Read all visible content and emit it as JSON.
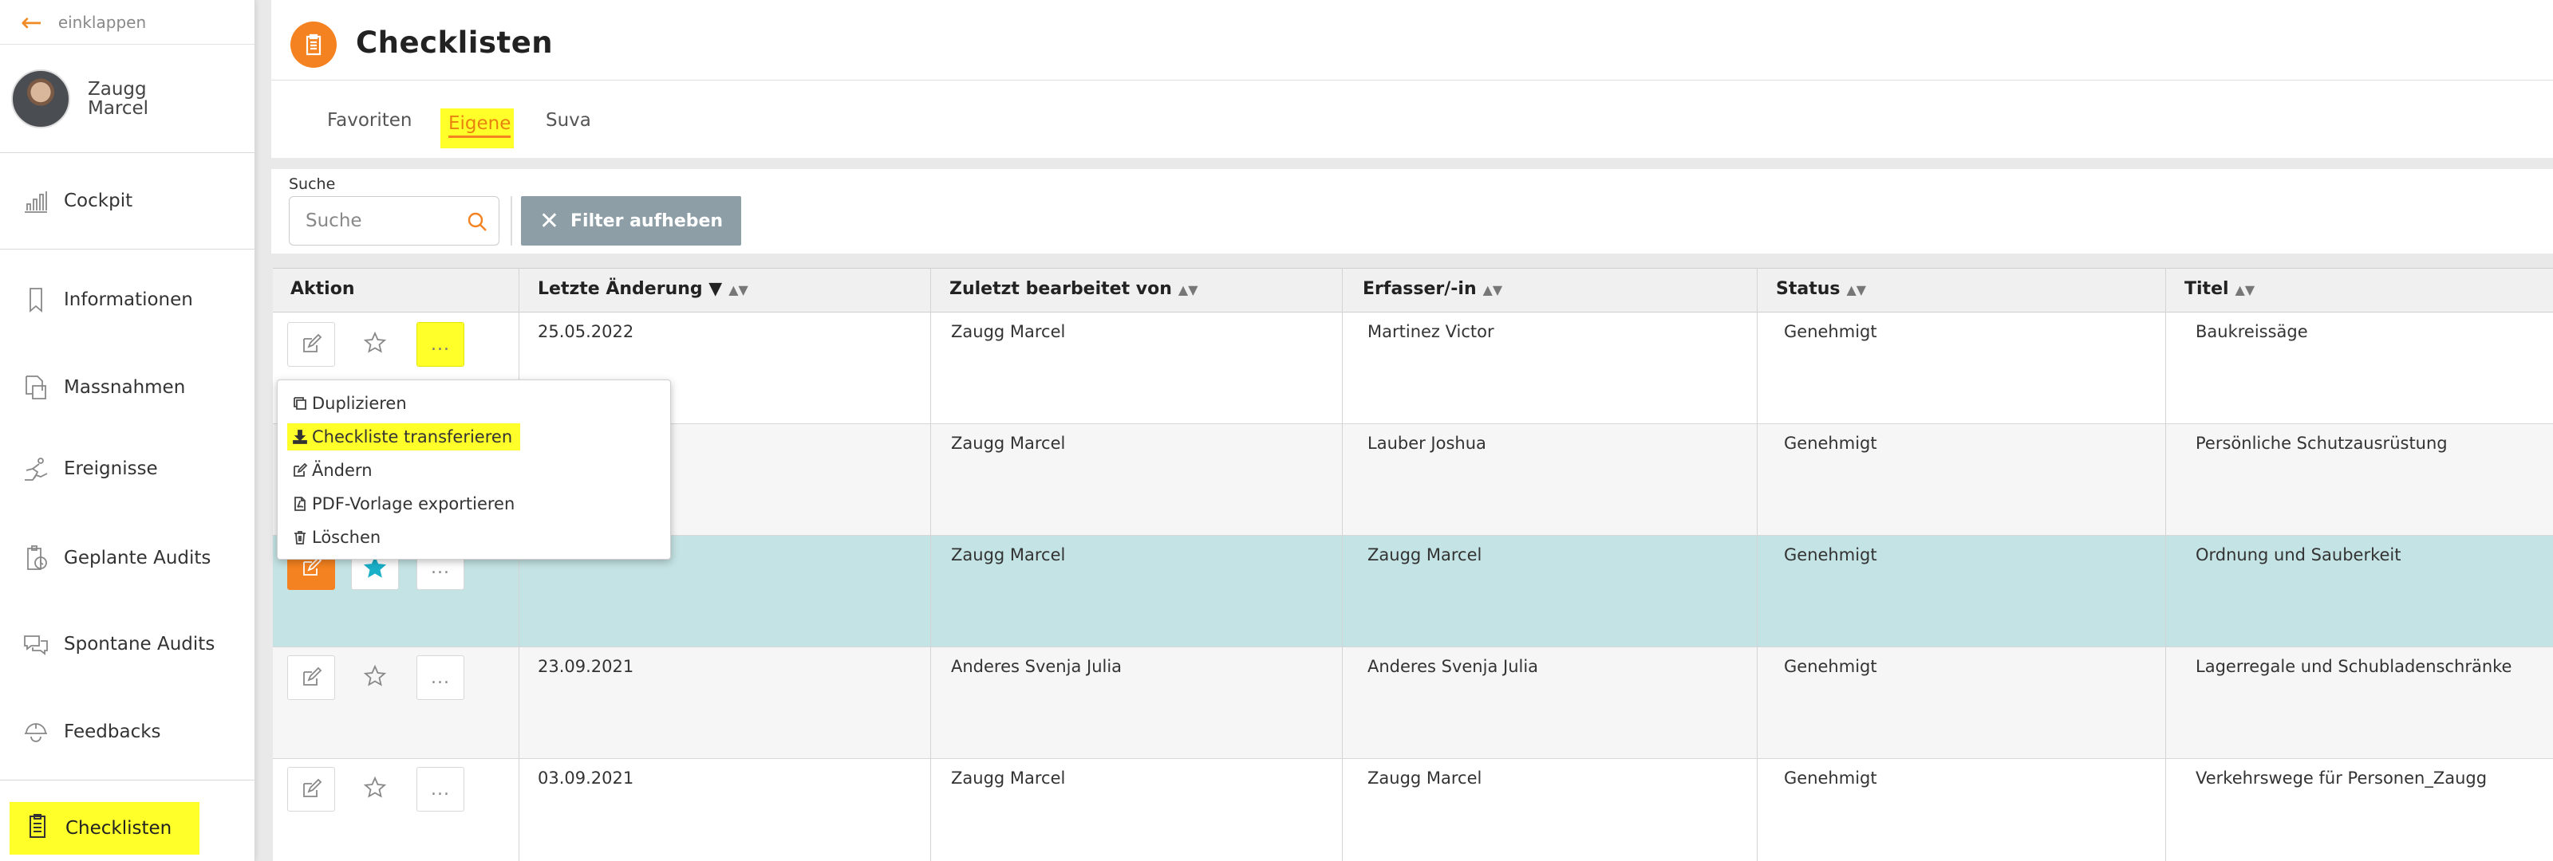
{
  "sidebar": {
    "collapse_label": "einklappen",
    "user_name_line1": "Zaugg",
    "user_name_line2": "Marcel",
    "items": [
      {
        "label": "Cockpit",
        "icon": "bar-chart-icon"
      },
      {
        "label": "Informationen",
        "icon": "bookmark-icon"
      },
      {
        "label": "Massnahmen",
        "icon": "documents-icon"
      },
      {
        "label": "Ereignisse",
        "icon": "fall-person-icon"
      },
      {
        "label": "Geplante Audits",
        "icon": "clock-clipboard-icon"
      },
      {
        "label": "Spontane Audits",
        "icon": "chat-bubbles-icon"
      },
      {
        "label": "Feedbacks",
        "icon": "helmet-icon"
      },
      {
        "label": "Checklisten",
        "icon": "clipboard-icon",
        "active": true
      }
    ]
  },
  "page": {
    "title": "Checklisten",
    "tabs": [
      "Favoriten",
      "Eigene",
      "Suva"
    ],
    "active_tab": "Eigene"
  },
  "search": {
    "label": "Suche",
    "placeholder": "Suche",
    "filter_button": "Filter aufheben"
  },
  "table": {
    "columns": [
      "Aktion",
      "Letzte Änderung ▼",
      "Zuletzt bearbeitet von",
      "Erfasser/-in",
      "Status",
      "Titel"
    ],
    "rows": [
      {
        "date": "25.05.2022",
        "edited_by": "Zaugg Marcel",
        "author": "Martinez Victor",
        "status": "Genehmigt",
        "title": "Baukreissäge"
      },
      {
        "date": "",
        "edited_by": "Zaugg Marcel",
        "author": "Lauber Joshua",
        "status": "Genehmigt",
        "title": "Persönliche Schutzausrüstung"
      },
      {
        "date": "",
        "edited_by": "Zaugg Marcel",
        "author": "Zaugg Marcel",
        "status": "Genehmigt",
        "title": "Ordnung und Sauberkeit"
      },
      {
        "date": "23.09.2021",
        "edited_by": "Anderes Svenja Julia",
        "author": "Anderes Svenja Julia",
        "status": "Genehmigt",
        "title": "Lagerregale und Schubladenschränke"
      },
      {
        "date": "03.09.2021",
        "edited_by": "Zaugg Marcel",
        "author": "Zaugg Marcel",
        "status": "Genehmigt",
        "title": "Verkehrswege für Personen_Zaugg"
      }
    ],
    "more_label": "..."
  },
  "menu": {
    "items": [
      {
        "label": "Duplizieren",
        "icon": "copy-icon"
      },
      {
        "label": "Checkliste transferieren",
        "icon": "download-icon",
        "highlighted": true
      },
      {
        "label": "Ändern",
        "icon": "edit-icon"
      },
      {
        "label": "PDF-Vorlage exportieren",
        "icon": "pdf-file-icon"
      },
      {
        "label": "Löschen",
        "icon": "trash-icon"
      }
    ]
  },
  "colors": {
    "accent": "#f58220",
    "highlight": "#ffff2a",
    "selected_row": "#c4e3e4",
    "filter_button": "#8d9ea6",
    "star_active": "#19b0c8"
  }
}
